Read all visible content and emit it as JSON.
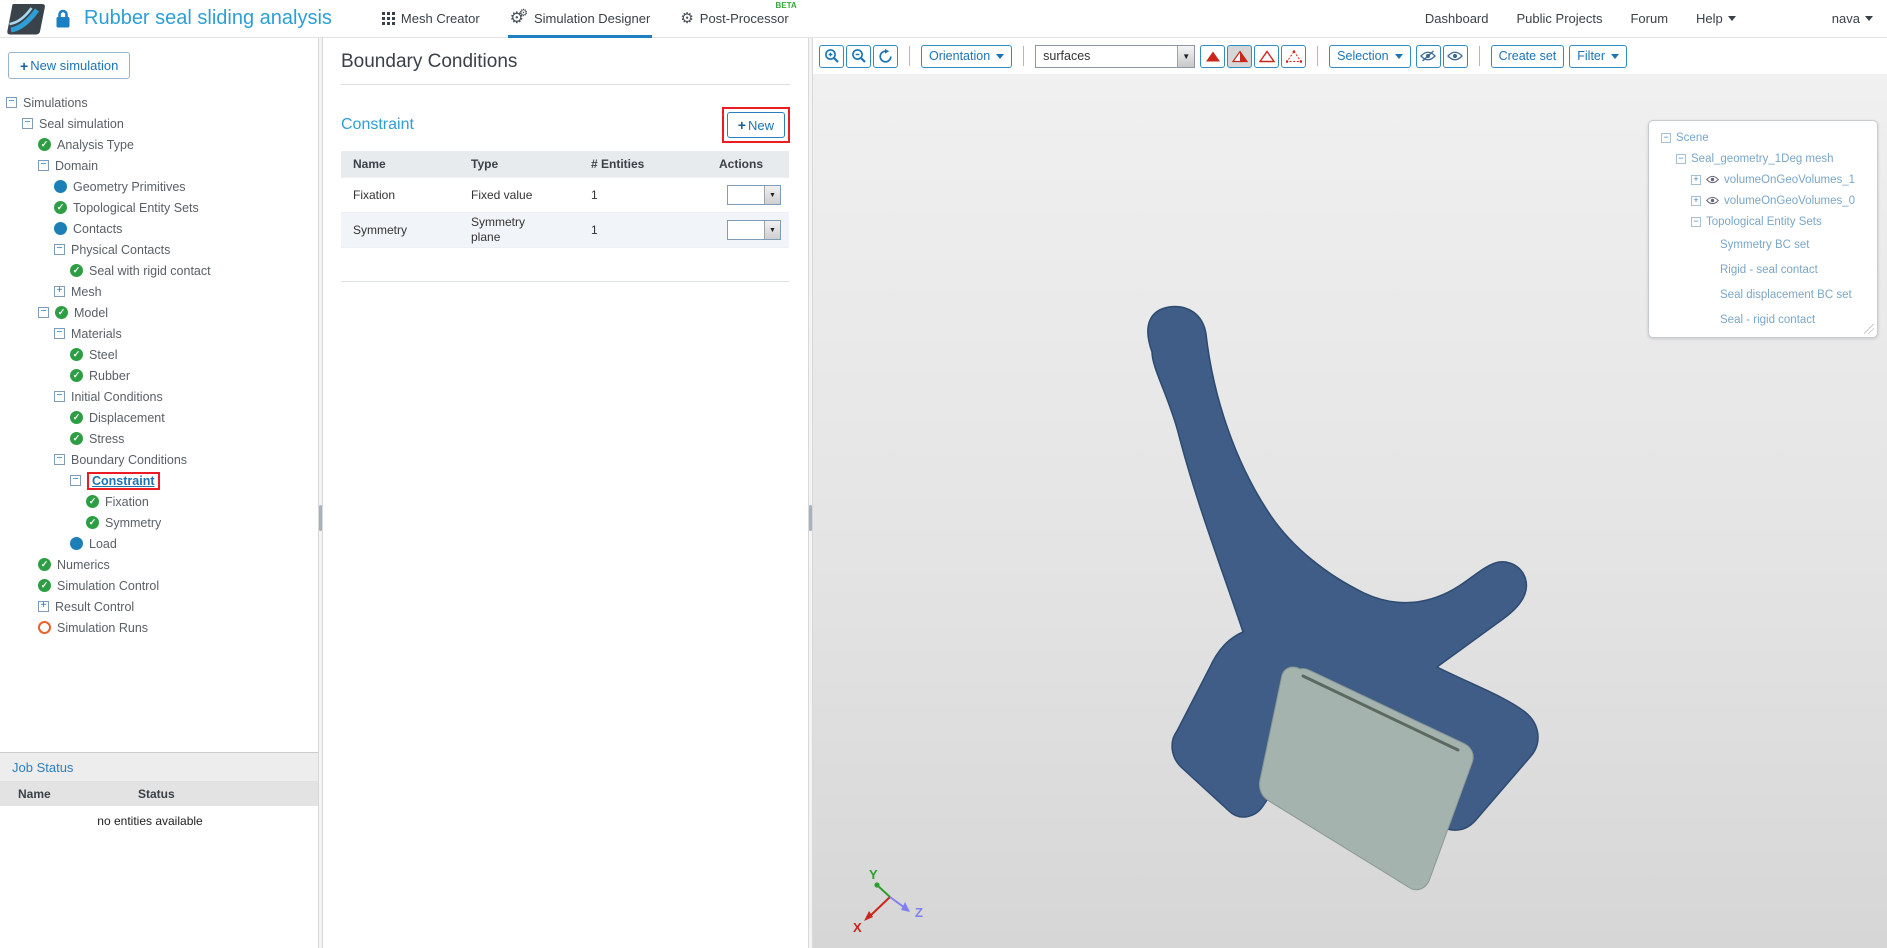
{
  "header": {
    "title": "Rubber seal sliding analysis",
    "tabs": [
      {
        "label": "Mesh Creator",
        "icon": "grid"
      },
      {
        "label": "Simulation Designer",
        "icon": "gears",
        "active": true
      },
      {
        "label": "Post-Processor",
        "icon": "gear",
        "badge": "BETA"
      }
    ],
    "nav": [
      {
        "label": "Dashboard"
      },
      {
        "label": "Public Projects"
      },
      {
        "label": "Forum"
      },
      {
        "label": "Help",
        "caret": true
      }
    ],
    "user": {
      "label": "nava",
      "caret": true
    }
  },
  "sidebar": {
    "new_button": {
      "plus": "+",
      "label": "New simulation"
    },
    "tree": [
      {
        "label": "Simulations",
        "level": 0,
        "expander": "minus"
      },
      {
        "label": "Seal simulation",
        "level": 1,
        "expander": "minus"
      },
      {
        "label": "Analysis Type",
        "level": 2,
        "status": "check"
      },
      {
        "label": "Domain",
        "level": 2,
        "expander": "minus"
      },
      {
        "label": "Geometry Primitives",
        "level": 3,
        "status": "dot"
      },
      {
        "label": "Topological Entity Sets",
        "level": 3,
        "status": "check"
      },
      {
        "label": "Contacts",
        "level": 3,
        "status": "dot"
      },
      {
        "label": "Physical Contacts",
        "level": 3,
        "expander": "minus"
      },
      {
        "label": "Seal with rigid contact",
        "level": 4,
        "status": "check"
      },
      {
        "label": "Mesh",
        "level": 3,
        "expander": "plus"
      },
      {
        "label": "Model",
        "level": 2,
        "expander": "minus",
        "status": "check"
      },
      {
        "label": "Materials",
        "level": 3,
        "expander": "minus"
      },
      {
        "label": "Steel",
        "level": 4,
        "status": "check"
      },
      {
        "label": "Rubber",
        "level": 4,
        "status": "check"
      },
      {
        "label": "Initial Conditions",
        "level": 3,
        "expander": "minus"
      },
      {
        "label": "Displacement",
        "level": 4,
        "status": "check"
      },
      {
        "label": "Stress",
        "level": 4,
        "status": "check"
      },
      {
        "label": "Boundary Conditions",
        "level": 3,
        "expander": "minus"
      },
      {
        "label": "Constraint",
        "level": 4,
        "expander": "minus",
        "selected": true
      },
      {
        "label": "Fixation",
        "level": 5,
        "status": "check"
      },
      {
        "label": "Symmetry",
        "level": 5,
        "status": "check"
      },
      {
        "label": "Load",
        "level": 4,
        "status": "dot"
      },
      {
        "label": "Numerics",
        "level": 2,
        "status": "check"
      },
      {
        "label": "Simulation Control",
        "level": 2,
        "status": "check"
      },
      {
        "label": "Result Control",
        "level": 2,
        "expander": "plus"
      },
      {
        "label": "Simulation Runs",
        "level": 2,
        "status": "circle"
      }
    ],
    "job_status": {
      "title": "Job Status",
      "columns": [
        "Name",
        "Status"
      ],
      "empty_text": "no entities available"
    }
  },
  "panel": {
    "title": "Boundary Conditions",
    "section": "Constraint",
    "new_button": {
      "plus": "+",
      "label": "New"
    },
    "table": {
      "columns": [
        "Name",
        "Type",
        "# Entities",
        "Actions"
      ],
      "rows": [
        {
          "name": "Fixation",
          "type": "Fixed value",
          "entities": "1"
        },
        {
          "name": "Symmetry",
          "type": "Symmetry plane",
          "entities": "1"
        }
      ]
    }
  },
  "viewport": {
    "toolbar": {
      "icons": [
        "zoom-in",
        "zoom-out",
        "refresh"
      ],
      "orientation_label": "Orientation",
      "mesh_display_value": "surfaces",
      "display_mode_icons": [
        "triangle-solid",
        "triangle-half-filled",
        "triangle-wireframe",
        "triangle-points"
      ],
      "active_display_mode": 1,
      "selection_label": "Selection",
      "visibility_icons": [
        "eye-off",
        "eye"
      ],
      "create_set_label": "Create set",
      "filter_label": "Filter"
    },
    "scene_tree": [
      {
        "label": "Scene",
        "level": 0,
        "expander": "minus"
      },
      {
        "label": "Seal_geometry_1Deg mesh",
        "level": 1,
        "expander": "minus"
      },
      {
        "label": "volumeOnGeoVolumes_1",
        "level": 2,
        "expander": "plus",
        "eye": true
      },
      {
        "label": "volumeOnGeoVolumes_0",
        "level": 2,
        "expander": "plus",
        "eye": true
      },
      {
        "label": "Topological Entity Sets",
        "level": 2,
        "expander": "minus"
      },
      {
        "label": "Symmetry BC set",
        "level": 3
      },
      {
        "label": "Rigid - seal contact",
        "level": 3
      },
      {
        "label": "Seal displacement BC set",
        "level": 3
      },
      {
        "label": "Seal - rigid contact",
        "level": 3
      }
    ],
    "axes": {
      "x": "X",
      "y": "Y",
      "z": "Z"
    },
    "model": {
      "seal_color": "#3f5d87",
      "plate_color": "#a5b3af"
    }
  },
  "colors": {
    "accent": "#2d9fd6",
    "link": "#1d74b5",
    "annotation_red": "#ec1c24",
    "check_green": "#2e9e44",
    "item_blue": "#1c7fb5",
    "runs_orange": "#e8622d",
    "axis_x": "#c9271c",
    "axis_y": "#2ca02c",
    "axis_z": "#8080f0"
  }
}
